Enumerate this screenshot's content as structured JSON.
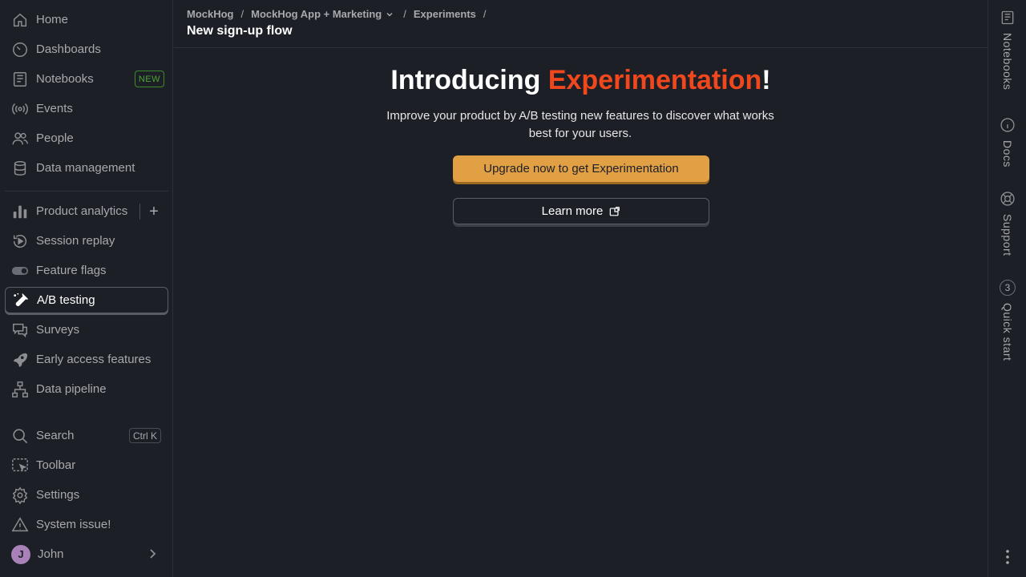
{
  "sidebar": {
    "top_items": [
      {
        "label": "Home",
        "icon": "home-icon"
      },
      {
        "label": "Dashboards",
        "icon": "dashboard-gauge-icon"
      },
      {
        "label": "Notebooks",
        "icon": "notebook-icon",
        "badge": "NEW"
      },
      {
        "label": "Events",
        "icon": "broadcast-icon"
      },
      {
        "label": "People",
        "icon": "people-icon"
      },
      {
        "label": "Data management",
        "icon": "database-icon"
      }
    ],
    "product_items": [
      {
        "label": "Product analytics",
        "icon": "bar-chart-icon"
      },
      {
        "label": "Session replay",
        "icon": "replay-icon"
      },
      {
        "label": "Feature flags",
        "icon": "toggle-icon"
      },
      {
        "label": "A/B testing",
        "icon": "flask-icon",
        "active": true
      },
      {
        "label": "Surveys",
        "icon": "chat-bubbles-icon"
      },
      {
        "label": "Early access features",
        "icon": "rocket-icon"
      },
      {
        "label": "Data pipeline",
        "icon": "pipeline-icon"
      }
    ],
    "bottom_items": [
      {
        "label": "Search",
        "icon": "search-icon",
        "shortcut": "Ctrl K"
      },
      {
        "label": "Toolbar",
        "icon": "toolbar-icon"
      },
      {
        "label": "Settings",
        "icon": "gear-icon"
      },
      {
        "label": "System issue!",
        "icon": "warning-icon"
      }
    ],
    "user": {
      "name": "John",
      "initial": "J"
    }
  },
  "breadcrumbs": {
    "org": "MockHog",
    "project": "MockHog App + Marketing",
    "section": "Experiments",
    "separator": "/"
  },
  "page_title": "New sign-up flow",
  "hero": {
    "title_prefix": "Introducing ",
    "title_accent": "Experimentation",
    "title_suffix": "!",
    "description": "Improve your product by A/B testing new features to discover what works best for your users.",
    "primary_button": "Upgrade now to get Experimentation",
    "secondary_button": "Learn more"
  },
  "right_panel": {
    "items": [
      {
        "label": "Notebooks",
        "icon": "notebook-icon"
      },
      {
        "label": "Docs",
        "icon": "info-icon"
      },
      {
        "label": "Support",
        "icon": "lifebuoy-icon"
      },
      {
        "label": "Quick start",
        "count": "3"
      }
    ]
  },
  "colors": {
    "background": "#1d1f27",
    "accent": "#f0481c",
    "primary_button": "#e2a045",
    "badge_new": "#4ca334",
    "avatar": "#a781b7"
  }
}
